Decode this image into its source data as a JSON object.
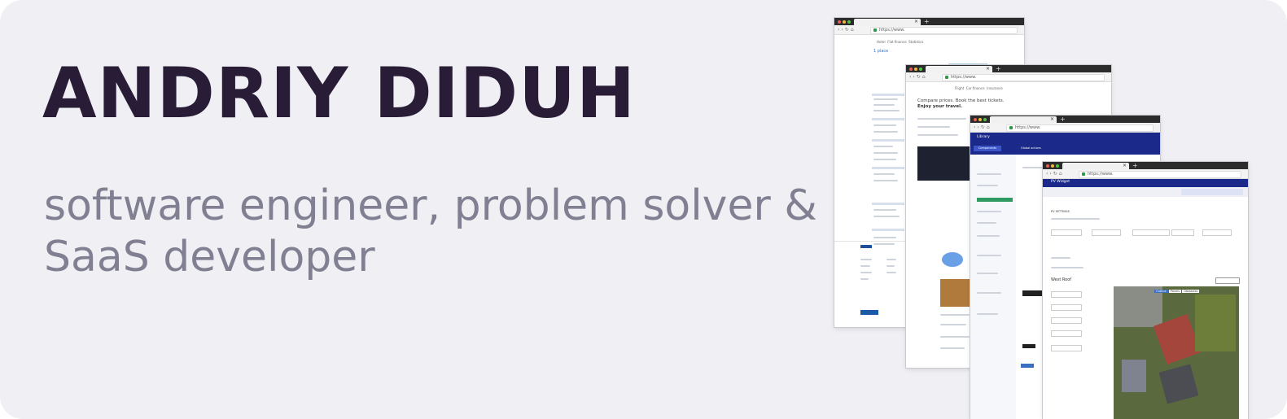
{
  "hero": {
    "name": "ANDRIY DIDUH",
    "tagline": "software engineer, problem solver & SaaS developer"
  },
  "colors": {
    "background": "#efeff4",
    "name": "#281c36",
    "tagline": "#808092"
  },
  "windows": [
    {
      "url": "https://www.",
      "nav_links": [
        "Hotel",
        "Flat finance",
        "Statistics"
      ],
      "rating_title": "1 place"
    },
    {
      "url": "https://www.",
      "nav_links": [
        "Flight",
        "Car finance",
        "Insurance"
      ],
      "headline": "Compare prices. Book the best tickets.",
      "subheadline": "Enjoy your travel."
    },
    {
      "url": "https://www.",
      "app_title": "Library",
      "tabs": [
        "Components library",
        "Global actions"
      ]
    },
    {
      "url": "https://www.",
      "app_title": "PV Widget",
      "section": "PV SETTINGS",
      "roof_title": "West Roof",
      "map_tabs": [
        "Outline",
        "Panels",
        "Obstacles"
      ]
    }
  ]
}
